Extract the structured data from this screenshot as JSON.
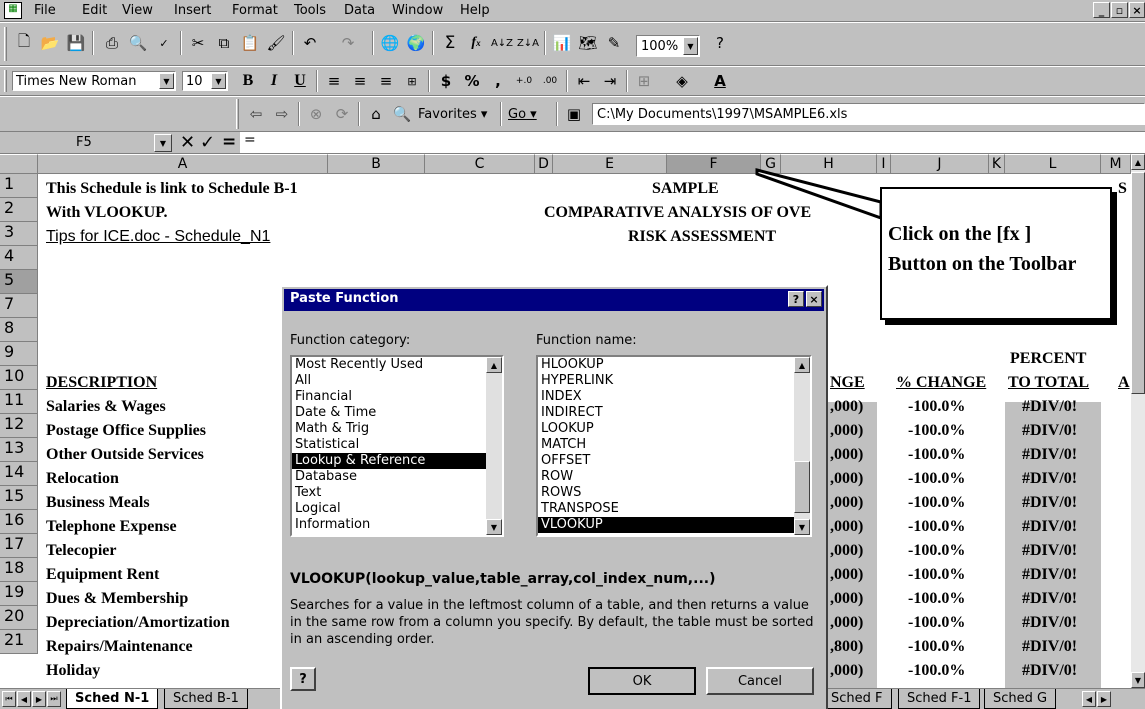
{
  "menu": [
    "File",
    "Edit",
    "View",
    "Insert",
    "Format",
    "Tools",
    "Data",
    "Window",
    "Help"
  ],
  "menu_underline": [
    "F",
    "E",
    "V",
    "I",
    "o",
    "T",
    "D",
    "W",
    "H"
  ],
  "toolbar": {
    "zoom": "100%"
  },
  "format": {
    "font": "Times New Roman",
    "size": "10",
    "bold": "B",
    "italic": "I",
    "underline": "U",
    "dollar": "$",
    "percent": "%",
    "comma": ","
  },
  "web": {
    "favorites": "Favorites",
    "go": "Go",
    "path": "C:\\My Documents\\1997\\MSAMPLE6.xls"
  },
  "formula": {
    "cell_ref": "F5",
    "equals": "=",
    "content": "="
  },
  "columns": [
    "A",
    "B",
    "C",
    "D",
    "E",
    "F",
    "G",
    "H",
    "I",
    "J",
    "K",
    "L",
    "M"
  ],
  "rows": [
    "1",
    "2",
    "3",
    "4",
    "5",
    "7",
    "8",
    "9",
    "10",
    "11",
    "12",
    "13",
    "14",
    "15",
    "16",
    "17",
    "18",
    "19",
    "20",
    "21"
  ],
  "cells": {
    "a1": "This Schedule is link to Schedule B-1",
    "a2": "With VLOOKUP.",
    "a3": "Tips for ICE.doc - Schedule_N1",
    "e1": "SAMPLE",
    "e2": "COMPARATIVE ANALYSIS OF OVE",
    "e3": "RISK ASSESSMENT",
    "m1": "S",
    "l8": "PERCENT",
    "a9": "DESCRIPTION",
    "h9": "NGE",
    "j9": "% CHANGE",
    "l9": "TO TOTAL",
    "m9": "A"
  },
  "descriptions": [
    "Salaries & Wages",
    "Postage Office Supplies",
    "Other Outside Services",
    "Relocation",
    "Business Meals",
    "Telephone Expense",
    "Telecopier",
    "Equipment Rent",
    "Dues & Membership",
    "Depreciation/Amortization",
    "Repairs/Maintenance",
    "Holiday"
  ],
  "h_values": [
    ",000)",
    ",000)",
    ",000)",
    ",000)",
    ",000)",
    ",000)",
    ",000)",
    ",000)",
    ",000)",
    ",000)",
    ",800)",
    ",000)"
  ],
  "j_values": [
    "-100.0%",
    "-100.0%",
    "-100.0%",
    "-100.0%",
    "-100.0%",
    "-100.0%",
    "-100.0%",
    "-100.0%",
    "-100.0%",
    "-100.0%",
    "-100.0%",
    "-100.0%"
  ],
  "l_values": [
    "#DIV/0!",
    "#DIV/0!",
    "#DIV/0!",
    "#DIV/0!",
    "#DIV/0!",
    "#DIV/0!",
    "#DIV/0!",
    "#DIV/0!",
    "#DIV/0!",
    "#DIV/0!",
    "#DIV/0!",
    "#DIV/0!"
  ],
  "callout": {
    "line1": "Click on the [fx ]",
    "line2": "Button on the Toolbar"
  },
  "dialog": {
    "title": "Paste Function",
    "category_label": "Function category:",
    "name_label": "Function name:",
    "categories": [
      "Most Recently Used",
      "All",
      "Financial",
      "Date & Time",
      "Math & Trig",
      "Statistical",
      "Lookup & Reference",
      "Database",
      "Text",
      "Logical",
      "Information"
    ],
    "selected_category": "Lookup & Reference",
    "functions": [
      "HLOOKUP",
      "HYPERLINK",
      "INDEX",
      "INDIRECT",
      "LOOKUP",
      "MATCH",
      "OFFSET",
      "ROW",
      "ROWS",
      "TRANSPOSE",
      "VLOOKUP"
    ],
    "selected_function": "VLOOKUP",
    "syntax": "VLOOKUP(lookup_value,table_array,col_index_num,...)",
    "description": "Searches for a value in the leftmost column of a table, and then returns a value in the same row from a column you specify. By default, the table must be sorted in an ascending order.",
    "ok": "OK",
    "cancel": "Cancel"
  },
  "sheet_tabs": [
    "Sched N-1",
    "Sched B-1"
  ],
  "sheet_tabs_right": [
    "Sched F",
    "Sched F-1",
    "Sched G"
  ]
}
